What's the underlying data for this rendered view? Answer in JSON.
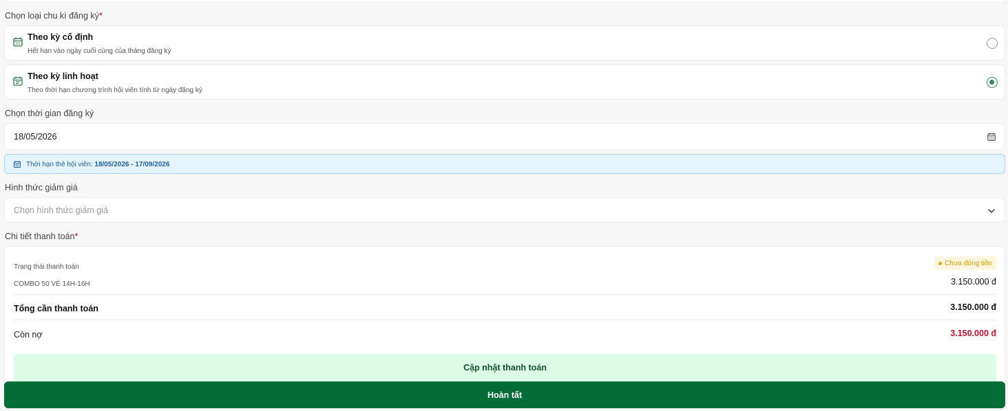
{
  "cycle": {
    "label": "Chọn loại chu kì đăng ký",
    "required_mark": "*",
    "options": [
      {
        "title": "Theo kỳ cố định",
        "description": "Hết hạn vào ngày cuối cùng của tháng đăng ký",
        "icon": "calendar-icon",
        "selected": false
      },
      {
        "title": "Theo kỳ linh hoạt",
        "description": "Theo thời hạn chương trình hội viên tính từ ngày đăng ký",
        "icon": "calendar-icon",
        "selected": true
      }
    ]
  },
  "date": {
    "label": "Chọn thời gian đăng ký",
    "value": "18/05/2026",
    "icon": "calendar-icon"
  },
  "membership": {
    "prefix": "Thời hạn thẻ hội viên:",
    "range": "18/05/2026 - 17/09/2026",
    "icon": "calendar-icon"
  },
  "discount": {
    "label": "Hình thức giảm giá",
    "placeholder": "Chọn hình thức giảm giá",
    "icon": "chevron-down-icon"
  },
  "payment": {
    "label": "Chi tiết thanh toán",
    "required_mark": "*",
    "status_label": "Trạng thái thanh toán",
    "status_badge": "Chưa đóng tiền",
    "item_name": "COMBO 50 VÉ 14H-16H",
    "item_price": "3.150.000 đ",
    "total_label": "Tổng cần thanh toán",
    "total_value": "3.150.000 đ",
    "debt_label": "Còn nợ",
    "debt_value": "3.150.000 đ",
    "update_button": "Cập nhật thanh toán"
  },
  "finish_button": "Hoàn tất",
  "colors": {
    "primary": "#046c37",
    "accent_green": "#2e8b57",
    "debt_red": "#c8102e",
    "badge_orange": "#e09b00",
    "info_blue": "#1d5fa8"
  }
}
